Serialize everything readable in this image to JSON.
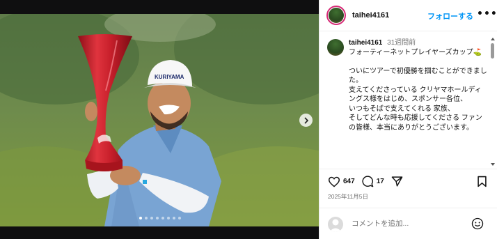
{
  "post": {
    "username": "taihei4161",
    "follow_label": "フォローする",
    "more_label": "•••",
    "caption": {
      "username": "taihei4161",
      "time": "31週間前",
      "text": "フォーティーネットプレイヤーズカップ⛳\n\nついにツアーで初優勝を掴むことができました。\n支えてくださっている クリヤマホールディングス様をはじめ、スポンサー各位、\nいつもそばで支えてくれる 家族、\nそしてどんな時も応援してくださる ファンの皆様、本当にありがとうございます。"
    },
    "likes": "647",
    "comments": "17",
    "date": "2025年11月5日",
    "comment_placeholder": "コメントを追加...",
    "cap_logo_text": "KURIYAMA",
    "carousel": {
      "count": 8,
      "active": 0
    }
  },
  "colors": {
    "accent": "#0095f6",
    "trophy": "#d01e2a",
    "shirt": "#7aa6d6"
  },
  "icons": [
    "chevron-right-icon",
    "heart-icon",
    "comment-icon",
    "share-icon",
    "bookmark-icon",
    "emoji-icon",
    "user-icon",
    "more-icon"
  ]
}
